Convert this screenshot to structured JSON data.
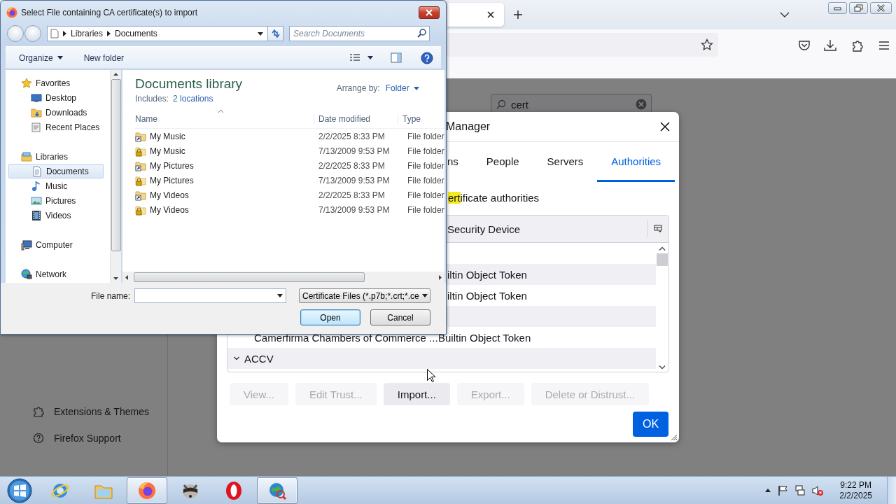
{
  "browser": {
    "sidebar": {
      "items": [
        {
          "label": "Extensions & Themes",
          "kind": "extensions"
        },
        {
          "label": "Firefox Support",
          "kind": "support"
        }
      ]
    },
    "search": {
      "value": "cert"
    }
  },
  "certificate_manager": {
    "title": "Manager",
    "tabs": [
      {
        "label": "ns",
        "selected": false
      },
      {
        "label": "People",
        "selected": false
      },
      {
        "label": "Servers",
        "selected": false
      },
      {
        "label": "Authorities",
        "selected": true
      }
    ],
    "description": {
      "highlighted": "ert",
      "text": "ificate authorities"
    },
    "column": "Security Device",
    "rows": [
      {
        "kind": "group"
      },
      {
        "kind": "cert",
        "token": "iltin Object Token"
      },
      {
        "kind": "cert",
        "token": "iltin Object Token"
      },
      {
        "kind": "group"
      },
      {
        "kind": "cert",
        "name": "Camerfirma Chambers of Commerce ...",
        "token": "Builtin Object Token"
      },
      {
        "kind": "group",
        "label": "ACCV",
        "expanded": true
      }
    ],
    "buttons": [
      {
        "label": "View...",
        "disabled": true
      },
      {
        "label": "Edit Trust...",
        "disabled": true
      },
      {
        "label": "Import...",
        "disabled": false
      },
      {
        "label": "Export...",
        "disabled": true
      },
      {
        "label": "Delete or Distrust...",
        "disabled": true
      }
    ],
    "ok": "OK"
  },
  "file_dialog": {
    "title": "Select File containing CA certificate(s) to import",
    "breadcrumb": [
      "Libraries",
      "Documents"
    ],
    "search": {
      "placeholder": "Search Documents"
    },
    "toolbar": [
      {
        "label": "Organize",
        "kind": "menu"
      },
      {
        "label": "New folder",
        "kind": "button"
      }
    ],
    "nav": [
      {
        "label": "Favorites",
        "kind": "favorites",
        "selected": false,
        "children": [
          {
            "label": "Desktop",
            "kind": "desktop",
            "selected": false
          },
          {
            "label": "Downloads",
            "kind": "downloads",
            "selected": false
          },
          {
            "label": "Recent Places",
            "kind": "recent",
            "selected": false
          }
        ]
      },
      {
        "label": "Libraries",
        "kind": "library",
        "selected": false,
        "children": [
          {
            "label": "Documents",
            "kind": "documents",
            "selected": true
          },
          {
            "label": "Music",
            "kind": "music",
            "selected": false
          },
          {
            "label": "Pictures",
            "kind": "pictures",
            "selected": false
          },
          {
            "label": "Videos",
            "kind": "videos",
            "selected": false
          }
        ]
      },
      {
        "label": "Computer",
        "kind": "computer",
        "selected": false
      },
      {
        "label": "Network",
        "kind": "network",
        "selected": false
      }
    ],
    "library": {
      "title": "Documents library",
      "includes_label": "Includes:",
      "includes_link": "2 locations",
      "arrange_label": "Arrange by:",
      "arrange_value": "Folder"
    },
    "columns": [
      "Name",
      "Date modified",
      "Type"
    ],
    "files": [
      {
        "name": "My Music",
        "kind": "shortcut",
        "date": "2/2/2025 8:33 PM",
        "type": "File folder"
      },
      {
        "name": "My Music",
        "kind": "locked",
        "date": "7/13/2009 9:53 PM",
        "type": "File folder"
      },
      {
        "name": "My Pictures",
        "kind": "shortcut",
        "date": "2/2/2025 8:33 PM",
        "type": "File folder"
      },
      {
        "name": "My Pictures",
        "kind": "locked",
        "date": "7/13/2009 9:53 PM",
        "type": "File folder"
      },
      {
        "name": "My Videos",
        "kind": "shortcut",
        "date": "2/2/2025 8:33 PM",
        "type": "File folder"
      },
      {
        "name": "My Videos",
        "kind": "locked",
        "date": "7/13/2009 9:53 PM",
        "type": "File folder"
      }
    ],
    "file_name_label": "File name:",
    "filter": "Certificate Files (*.p7b;*.crt;*.ce",
    "buttons": [
      {
        "label": "Open",
        "default": true
      },
      {
        "label": "Cancel",
        "default": false
      }
    ]
  },
  "taskbar": {
    "apps": [
      {
        "kind": "ie",
        "active": false
      },
      {
        "kind": "explorer",
        "active": false
      },
      {
        "kind": "firefox",
        "active": true
      },
      {
        "kind": "raccoon",
        "active": false
      },
      {
        "kind": "opera",
        "active": false
      },
      {
        "kind": "globe",
        "active": true
      }
    ],
    "clock": {
      "time": "9:22 PM",
      "date": "2/2/2025"
    }
  }
}
